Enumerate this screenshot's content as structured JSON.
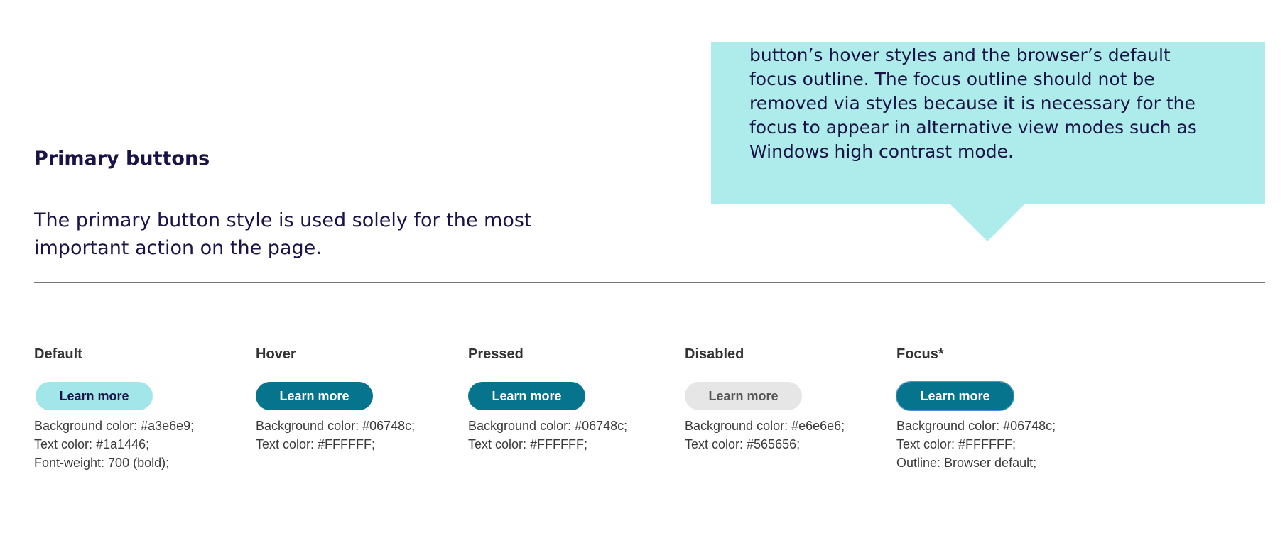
{
  "callout": {
    "lines": [
      "button’s hover styles and the browser’s default",
      "focus outline. The focus outline should not be",
      "removed via styles because it is necessary for the",
      "focus to appear in alternative view modes such as",
      "Windows high contrast mode."
    ],
    "background": "#aeeceb"
  },
  "section": {
    "title": "Primary buttons",
    "description_lines": [
      "The primary button style is used solely for the most",
      "important action on the page."
    ]
  },
  "variants": [
    {
      "label": "Default",
      "button_label": "Learn more",
      "specs": [
        "Background color: #a3e6e9;",
        "Text color: #1a1446;",
        "Font-weight: 700 (bold);"
      ],
      "bg": "#a3e6e9",
      "fg": "#1a1446"
    },
    {
      "label": "Hover",
      "button_label": "Learn more",
      "specs": [
        "Background color: #06748c;",
        "Text color: #FFFFFF;"
      ],
      "bg": "#06748c",
      "fg": "#FFFFFF"
    },
    {
      "label": "Pressed",
      "button_label": "Learn more",
      "specs": [
        "Background color: #06748c;",
        "Text color: #FFFFFF;"
      ],
      "bg": "#06748c",
      "fg": "#FFFFFF"
    },
    {
      "label": "Disabled",
      "button_label": "Learn more",
      "specs": [
        "Background color: #e6e6e6;",
        "Text color: #565656;"
      ],
      "bg": "#e6e6e6",
      "fg": "#565656"
    },
    {
      "label": "Focus*",
      "button_label": "Learn more",
      "specs": [
        "Background color: #06748c;",
        "Text color: #FFFFFF;",
        "Outline: Browser default;"
      ],
      "bg": "#06748c",
      "fg": "#FFFFFF"
    }
  ]
}
